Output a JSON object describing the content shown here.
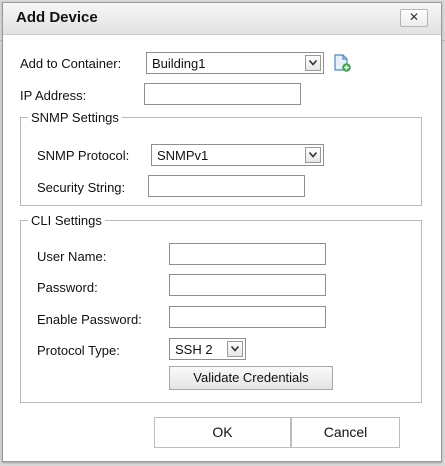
{
  "dialog": {
    "title": "Add Device",
    "close_label": "✕"
  },
  "form": {
    "container_label": "Add to Container:",
    "container_value": "Building1",
    "ip_label": "IP Address:",
    "ip_value": ""
  },
  "snmp": {
    "legend": "SNMP Settings",
    "protocol_label": "SNMP Protocol:",
    "protocol_value": "SNMPv1",
    "security_label": "Security String:",
    "security_value": ""
  },
  "cli": {
    "legend": "CLI Settings",
    "username_label": "User Name:",
    "password_label": "Password:",
    "enable_password_label": "Enable Password:",
    "protocol_type_label": "Protocol Type:",
    "protocol_type_value": "SSH 2",
    "validate_label": "Validate Credentials"
  },
  "footer": {
    "ok_label": "OK",
    "cancel_label": "Cancel"
  },
  "icons": {
    "add_container": "add-document-icon",
    "dropdown": "chevron-down-icon"
  },
  "colors": {
    "accent_green": "#3aa84a",
    "icon_blue": "#4a86c8"
  }
}
